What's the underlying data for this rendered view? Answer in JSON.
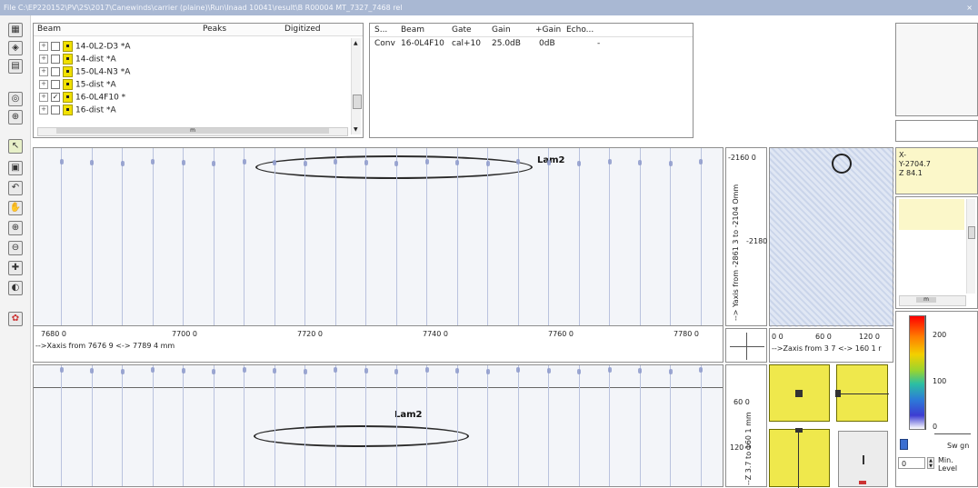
{
  "window": {
    "title": "File C:\\EP220152\\PV\\2S\\2017\\Canewinds\\carrier (plaine)\\Run\\Inaad 10041\\result\\B R00004 MT_7327_7468 rel",
    "close_glyph": "×"
  },
  "toolbar": {
    "icons": [
      "grid-icon",
      "layers-icon",
      "export-icon",
      "scan-icon",
      "fit-icon",
      "select-icon",
      "frame-icon",
      "undo-icon",
      "pan-icon",
      "zoom-in-icon",
      "zoom-out-icon",
      "crosshair-icon",
      "measure-icon",
      "palette-icon"
    ]
  },
  "beam_tree": {
    "columns": [
      "Beam",
      "Peaks",
      "Digitized"
    ],
    "rows": [
      {
        "label": "14-0L2-D3 *A",
        "checked": false
      },
      {
        "label": "14-dist *A",
        "checked": false
      },
      {
        "label": "15-0L4-N3 *A",
        "checked": false
      },
      {
        "label": "15-dist *A",
        "checked": false
      },
      {
        "label": "16-0L4F10 *",
        "checked": true
      },
      {
        "label": "16-dist *A",
        "checked": false
      }
    ],
    "scroll_label": "m"
  },
  "beam_table": {
    "columns": [
      "S...",
      "Beam",
      "Gate",
      "Gain",
      "+Gain",
      "Echo..."
    ],
    "row": [
      "Conv",
      "16-0L4F10",
      "cal+10",
      "25.0dB",
      "0dB",
      "-"
    ]
  },
  "cscan": {
    "annotation": "Lam2",
    "x_ticks": [
      "7680 0",
      "7700 0",
      "7720 0",
      "7740 0",
      "7760 0",
      "7780 0"
    ],
    "x_axis_label": "-->Xaxis  from 7676 9 <-> 7789 4 mm",
    "y_ticks": [
      "-2160 0",
      "-2180 0"
    ],
    "y_axis_label": "--> Yaxis from -2861 3 to -2104 Omm"
  },
  "endview": {
    "z_ticks": [
      "0 0",
      "60 0",
      "120 0"
    ],
    "z_axis_label": "-->Zaxis  from 3 7 <-> 160 1 r"
  },
  "bscan": {
    "annotation": "Lam2",
    "z_ticks": [
      "60 0",
      "120 0"
    ],
    "z_axis_label": "--Z 3.7 to 160 1 mm"
  },
  "coords": {
    "x": "X-",
    "y": "Y-2704.7",
    "z": "Z 84.1"
  },
  "inner_scroll": {
    "label": "m"
  },
  "palette": {
    "ticks": [
      "200",
      "100",
      "0"
    ],
    "gain_label": "Sw gn",
    "level_value": "0",
    "level_label": "Min. Level"
  },
  "colors": {
    "accent_yellow": "#efe84c",
    "scan_stripe": "#b9c2de",
    "titlebar": "#a9b8d3"
  }
}
